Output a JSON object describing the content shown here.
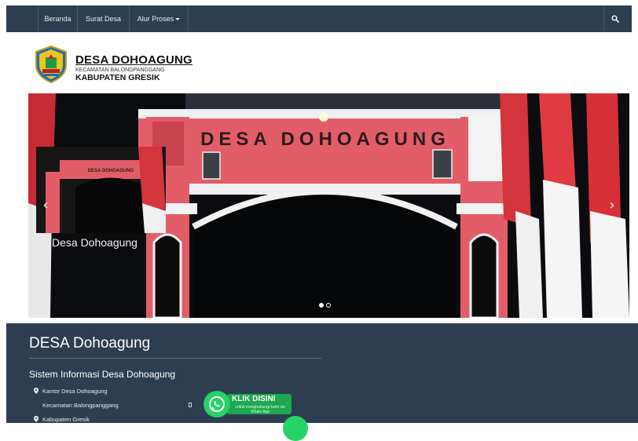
{
  "navbar": {
    "items": [
      {
        "label": "Beranda"
      },
      {
        "label": "Surat Desa"
      },
      {
        "label": "Alur Proses"
      }
    ],
    "search_icon": "search-icon"
  },
  "header": {
    "title": "DESA DOHOAGUNG",
    "subtitle": "KECAMATAN BALONGPANGGANG",
    "regency": "KABUPATEN GRESIK"
  },
  "carousel": {
    "gate_text": "DESA DOHOAGUNG",
    "caption": "Desa Dohoagung",
    "prev_icon": "chevron-left-icon",
    "next_icon": "chevron-right-icon",
    "slide_count": 2,
    "active_slide": 1
  },
  "footer": {
    "title": "DESA Dohoagung",
    "subtitle": "Sistem Informasi Desa Dohoagung",
    "lines": [
      "Kantor Desa Dohoagung",
      "Kecamatan Balongpanggang",
      "Kabupaten Gresik"
    ]
  },
  "whatsapp": {
    "title": "KLIK DISINI",
    "note": "untuk menghubungi kami via Whats App",
    "icon": "whatsapp-icon"
  },
  "colors": {
    "navbar_bg": "#2c3e50",
    "footer_bg": "#2c3e50",
    "gate_red": "#e35d68",
    "whatsapp_green": "#25d366"
  }
}
